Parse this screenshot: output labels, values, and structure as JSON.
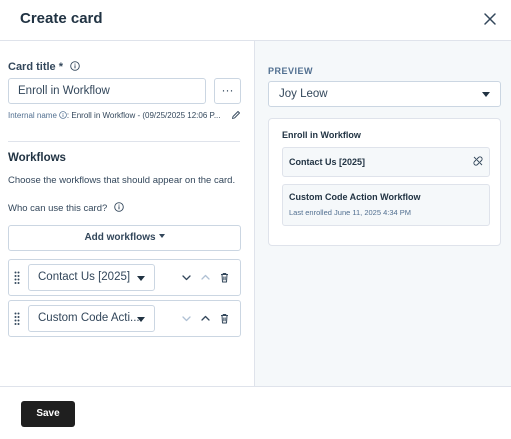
{
  "header": {
    "title": "Create card"
  },
  "form": {
    "card_title_label": "Card title *",
    "card_title_value": "Enroll in Workflow",
    "more_button_label": "···",
    "internal_name_label": "Internal name",
    "internal_name_value": ": Enroll in Workflow - (09/25/2025 12:06 P..."
  },
  "workflows": {
    "title": "Workflows",
    "description": "Choose the workflows that should appear on the card.",
    "who_label": "Who can use this card?",
    "add_button": "Add workflows",
    "rows": [
      {
        "name": "Contact Us [2025]"
      },
      {
        "name": "Custom Code Acti..."
      }
    ]
  },
  "footer": {
    "save_label": "Save"
  },
  "preview": {
    "label": "PREVIEW",
    "selected_contact": "Joy Leow",
    "card_title": "Enroll in Workflow",
    "items": [
      {
        "name": "Contact Us [2025]"
      },
      {
        "name": "Custom Code Action Workflow",
        "sub": "Last enrolled June 11, 2025 4:34 PM"
      }
    ]
  },
  "colors": {
    "text": "#33475b",
    "heading": "#213343",
    "border": "#cbd6e2",
    "panel_bg": "#f5f8fa",
    "save_button_bg": "#1f1f1f"
  },
  "icons": [
    "close-icon",
    "info-icon",
    "pencil-icon",
    "drag-handle-icon",
    "chevron-down-icon",
    "chevron-up-icon",
    "trash-icon",
    "unlink-icon"
  ]
}
